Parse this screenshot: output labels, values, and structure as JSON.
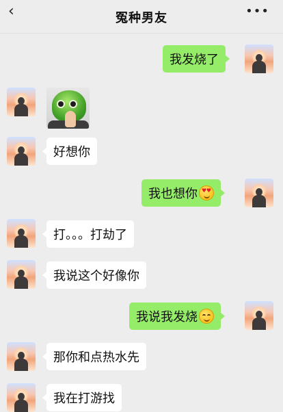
{
  "header": {
    "back_icon": "chevron-left",
    "title": "冤种男友",
    "more_icon": "ellipsis"
  },
  "messages": [
    {
      "side": "out",
      "type": "text",
      "text": "我发烧了"
    },
    {
      "side": "in",
      "type": "sticker",
      "description_icon": "green-mask-sticker"
    },
    {
      "side": "in",
      "type": "text",
      "text": "好想你"
    },
    {
      "side": "out",
      "type": "text",
      "text": "我也想你",
      "emoji": "heart-eyes-emoji"
    },
    {
      "side": "in",
      "type": "text",
      "text": "打。。。打劫了"
    },
    {
      "side": "in",
      "type": "text",
      "text": "我说这个好像你"
    },
    {
      "side": "out",
      "type": "text",
      "text": "我说我发烧",
      "emoji": "smiling-emoji"
    },
    {
      "side": "in",
      "type": "text",
      "text": "那你和点热水先"
    },
    {
      "side": "in",
      "type": "text",
      "text": "我在打游找"
    }
  ],
  "colors": {
    "background": "#ededed",
    "outgoing_bubble": "#95ec69",
    "incoming_bubble": "#ffffff"
  }
}
